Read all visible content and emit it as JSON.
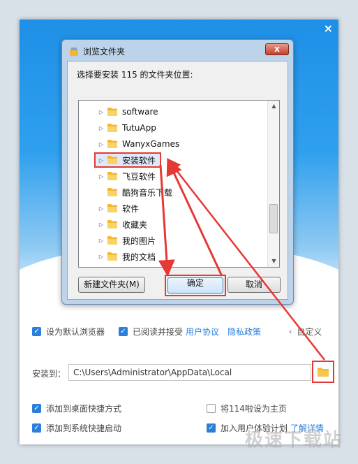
{
  "installer": {
    "close_label": "×",
    "set_default_browser": "设为默认浏览器",
    "agree_prefix": "已阅读并接受",
    "user_agreement": "用户协议",
    "privacy_policy": "隐私政策",
    "custom_label": "自定义",
    "install_to_label": "安装到：",
    "install_path": "C:\\Users\\Administrator\\AppData\\Local",
    "add_desktop_shortcut": "添加到桌面快捷方式",
    "add_quick_launch": "添加到系统快捷启动",
    "set_homepage": "将114啦设为主页",
    "join_ux_program": "加入用户体验计划",
    "learn_more": "了解详情",
    "checkbox_states": {
      "default_browser": true,
      "agree": true,
      "desktop": true,
      "quick_launch": true,
      "homepage": false,
      "ux": true
    }
  },
  "dialog": {
    "title": "浏览文件夹",
    "close_label": "x",
    "prompt": "选择要安装 115 的文件夹位置:",
    "tree_items": [
      {
        "label": "software",
        "expandable": true
      },
      {
        "label": "TutuApp",
        "expandable": true
      },
      {
        "label": "WanyxGames",
        "expandable": true
      },
      {
        "label": "安装软件",
        "expandable": true,
        "selected": true
      },
      {
        "label": "飞豆软件",
        "expandable": true
      },
      {
        "label": "酷狗音乐下载",
        "expandable": false
      },
      {
        "label": "软件",
        "expandable": true
      },
      {
        "label": "收藏夹",
        "expandable": true
      },
      {
        "label": "我的图片",
        "expandable": true
      },
      {
        "label": "我的文档",
        "expandable": true
      }
    ],
    "new_folder_button": "新建文件夹(M)",
    "ok_button": "确定",
    "cancel_button": "取消"
  },
  "watermark": "极速下载站",
  "colors": {
    "accent": "#2b7fd8",
    "highlight": "#e53935",
    "folder": "#f2b632"
  }
}
